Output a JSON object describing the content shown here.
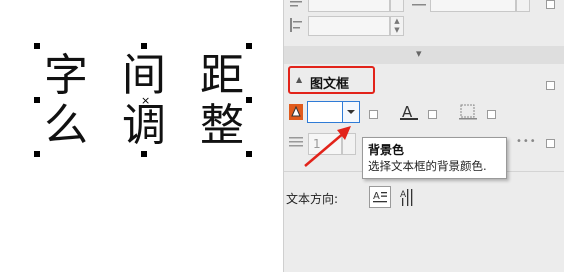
{
  "canvas": {
    "glyphs": [
      "字",
      "间",
      "距",
      "么",
      "调",
      "整"
    ]
  },
  "panel": {
    "section_title": "图文框",
    "section_arrow": "▲",
    "collapse_arrow": "▾",
    "spin_value": "1",
    "more_dots": "•••",
    "tooltip": {
      "title": "背景色",
      "description": "选择文本框的背景颜色."
    },
    "text_direction_label": "文本方向:",
    "colors": {
      "highlight_border": "#e2231a",
      "arrow": "#e2231a",
      "active_field_border": "#2f7bd6",
      "fill_icon": "#e05a1c"
    }
  }
}
